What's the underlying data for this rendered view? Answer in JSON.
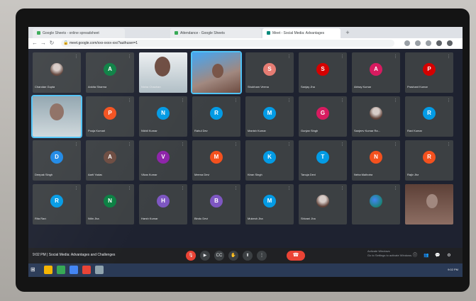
{
  "browser": {
    "tabs": [
      {
        "label": "Google Sheets - online spreadsheet",
        "active": false,
        "favicon_color": "#34a853"
      },
      {
        "label": "Attendance - Google Sheets",
        "active": false,
        "favicon_color": "#34a853"
      },
      {
        "label": "Meet - Social Media: Advantages",
        "active": true,
        "favicon_color": "#00897b"
      }
    ],
    "new_tab_label": "+",
    "url": "meet.google.com/xxx-xxxx-xxx?authuser=1"
  },
  "participants": [
    {
      "name": "Chandan Gupta",
      "initial": "",
      "color": "#3c4043",
      "muted": true,
      "type": "avatar-photo"
    },
    {
      "name": "Ankita Sharma",
      "initial": "A",
      "color": "#0b8043",
      "muted": true,
      "type": "initial"
    },
    {
      "name": "Nisha Chauhan",
      "initial": "",
      "color": "#3c4043",
      "muted": true,
      "type": "video"
    },
    {
      "name": "",
      "initial": "",
      "color": "#3c4043",
      "muted": false,
      "type": "video"
    },
    {
      "name": "Shubham Verma",
      "initial": "S",
      "color": "#e67c73",
      "muted": true,
      "type": "initial"
    },
    {
      "name": "Sanjay Jha",
      "initial": "S",
      "color": "#d50000",
      "muted": true,
      "type": "initial"
    },
    {
      "name": "Abhay Kumar",
      "initial": "A",
      "color": "#d81b60",
      "muted": true,
      "type": "initial"
    },
    {
      "name": "Prashant Kumar",
      "initial": "P",
      "color": "#d50000",
      "muted": true,
      "type": "initial"
    },
    {
      "name": "",
      "initial": "",
      "color": "#3c4043",
      "muted": false,
      "type": "video-presenter"
    },
    {
      "name": "Pooja Kumari",
      "initial": "P",
      "color": "#f4511e",
      "muted": true,
      "type": "initial"
    },
    {
      "name": "Nikhil Kumar",
      "initial": "N",
      "color": "#039be5",
      "muted": true,
      "type": "initial"
    },
    {
      "name": "Rahul Dev",
      "initial": "R",
      "color": "#039be5",
      "muted": true,
      "type": "initial"
    },
    {
      "name": "Manish Kumar",
      "initial": "M",
      "color": "#039be5",
      "muted": true,
      "type": "initial"
    },
    {
      "name": "Gunjan Singh",
      "initial": "G",
      "color": "#d81b60",
      "muted": true,
      "type": "initial"
    },
    {
      "name": "Sanjeev Kumar Ra...",
      "initial": "",
      "color": "#3c4043",
      "muted": true,
      "type": "avatar-photo"
    },
    {
      "name": "Ravi Kumar",
      "initial": "R",
      "color": "#039be5",
      "muted": true,
      "type": "initial"
    },
    {
      "name": "Deepak Singh",
      "initial": "D",
      "color": "#1e88e5",
      "muted": true,
      "type": "initial"
    },
    {
      "name": "Aarti Yadav",
      "initial": "A",
      "color": "#6d4c41",
      "muted": true,
      "type": "initial"
    },
    {
      "name": "Vikas Kumar",
      "initial": "V",
      "color": "#8e24aa",
      "muted": true,
      "type": "initial"
    },
    {
      "name": "Meena Devi",
      "initial": "M",
      "color": "#f4511e",
      "muted": true,
      "type": "initial"
    },
    {
      "name": "Kiran Singh",
      "initial": "K",
      "color": "#039be5",
      "muted": true,
      "type": "initial"
    },
    {
      "name": "Tanuja Devi",
      "initial": "T",
      "color": "#039be5",
      "muted": true,
      "type": "initial"
    },
    {
      "name": "Neha Malhotra",
      "initial": "N",
      "color": "#f4511e",
      "muted": true,
      "type": "initial"
    },
    {
      "name": "Rajiv Jha",
      "initial": "R",
      "color": "#f4511e",
      "muted": true,
      "type": "initial"
    },
    {
      "name": "Rita Rani",
      "initial": "R",
      "color": "#039be5",
      "muted": true,
      "type": "initial"
    },
    {
      "name": "Nitin Jha",
      "initial": "N",
      "color": "#0b8043",
      "muted": true,
      "type": "initial"
    },
    {
      "name": "Harsh Kumar",
      "initial": "H",
      "color": "#7e57c2",
      "muted": true,
      "type": "initial"
    },
    {
      "name": "Bindu Devi",
      "initial": "B",
      "color": "#7e57c2",
      "muted": true,
      "type": "initial"
    },
    {
      "name": "Mukesh Jha",
      "initial": "M",
      "color": "#039be5",
      "muted": true,
      "type": "initial"
    },
    {
      "name": "Shivani Jha",
      "initial": "",
      "color": "#3c4043",
      "muted": true,
      "type": "avatar-photo"
    },
    {
      "name": "",
      "initial": "",
      "color": "#3c4043",
      "muted": true,
      "type": "avatar-logo"
    },
    {
      "name": "",
      "initial": "",
      "color": "#3c4043",
      "muted": false,
      "type": "video"
    }
  ],
  "meeting": {
    "time": "9:02 PM",
    "title": "Social Media: Advantages and Challenges"
  },
  "controls": [
    {
      "name": "mic",
      "glyph": "🎙",
      "red": true
    },
    {
      "name": "camera",
      "glyph": "▶",
      "red": false
    },
    {
      "name": "captions",
      "glyph": "CC",
      "red": false
    },
    {
      "name": "raise-hand",
      "glyph": "✋",
      "red": false
    },
    {
      "name": "present",
      "glyph": "⬆",
      "red": false
    },
    {
      "name": "more",
      "glyph": "⋮",
      "red": false
    },
    {
      "name": "end-call",
      "glyph": "☎",
      "red": true
    }
  ],
  "activate_windows": {
    "line1": "Activate Windows",
    "line2": "Go to Settings to activate Windows."
  },
  "taskbar_apps": [
    "#f4b400",
    "#34a853",
    "#4285f4",
    "#ea4335",
    "#90a4ae"
  ],
  "tray_time": "9:02 PM"
}
